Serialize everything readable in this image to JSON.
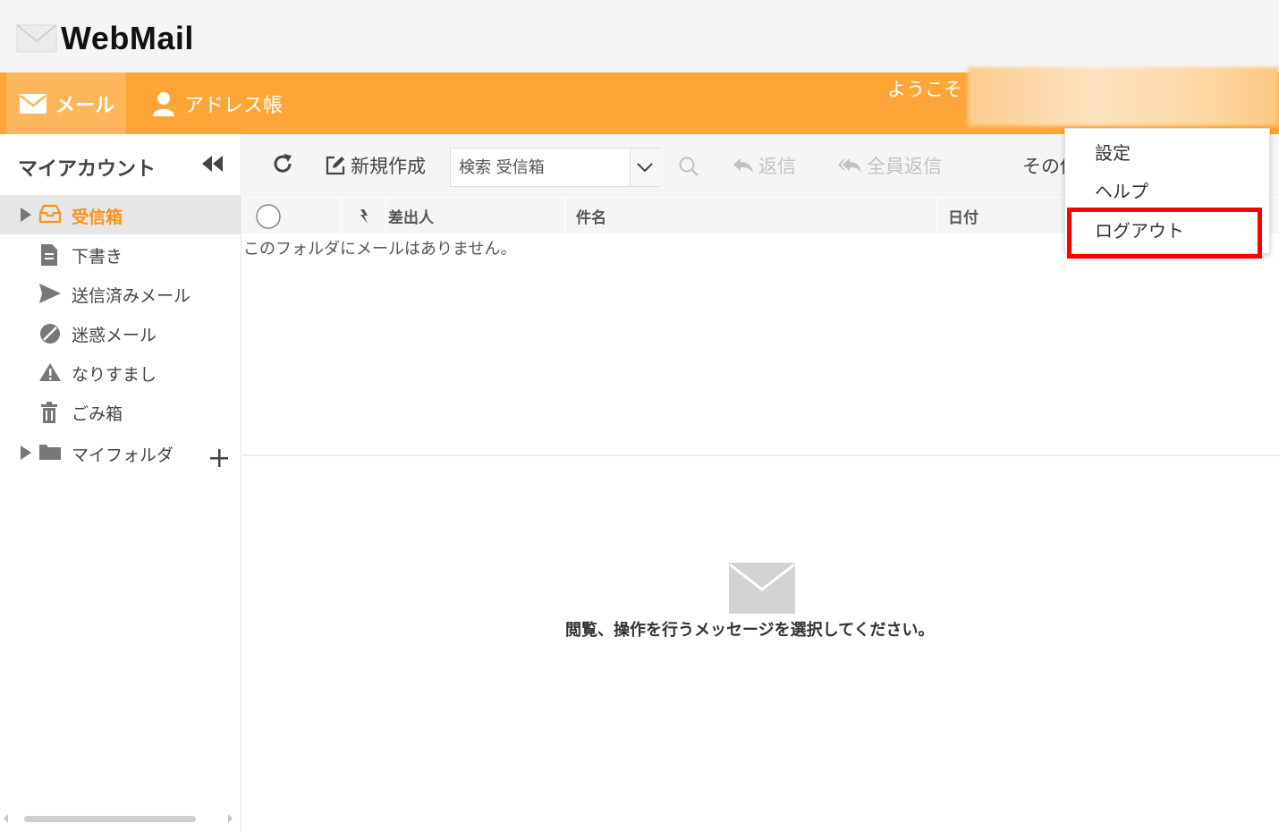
{
  "header": {
    "logo_text": "WebMail"
  },
  "nav": {
    "tabs": [
      {
        "label": "メール",
        "icon": "envelope-icon",
        "active": true
      },
      {
        "label": "アドレス帳",
        "icon": "person-icon",
        "active": false
      }
    ],
    "welcome": "ようこそ"
  },
  "sidebar": {
    "title": "マイアカウント",
    "folders": [
      {
        "label": "受信箱",
        "icon": "inbox-icon",
        "active": true
      },
      {
        "label": "下書き",
        "icon": "document-icon"
      },
      {
        "label": "送信済みメール",
        "icon": "send-icon"
      },
      {
        "label": "迷惑メール",
        "icon": "blocked-icon"
      },
      {
        "label": "なりすまし",
        "icon": "warning-icon"
      },
      {
        "label": "ごみ箱",
        "icon": "trash-icon"
      },
      {
        "label": "マイフォルダ",
        "icon": "folder-icon"
      }
    ]
  },
  "toolbar": {
    "compose": "新規作成",
    "search_placeholder": "検索 受信箱",
    "reply": "返信",
    "reply_all": "全員返信",
    "more": "その他"
  },
  "list": {
    "columns": {
      "from": "差出人",
      "subject": "件名",
      "date": "日付"
    },
    "empty_message": "このフォルダにメールはありません。"
  },
  "preview": {
    "message": "閲覧、操作を行うメッセージを選択してください。"
  },
  "menu": {
    "items": [
      "設定",
      "ヘルプ",
      "ログアウト"
    ],
    "highlighted": "ログアウト"
  },
  "colors": {
    "accent": "#fea537",
    "accent_light": "#fdb75a",
    "active_folder_text": "#f7931e",
    "highlight_border": "#ff0000"
  }
}
